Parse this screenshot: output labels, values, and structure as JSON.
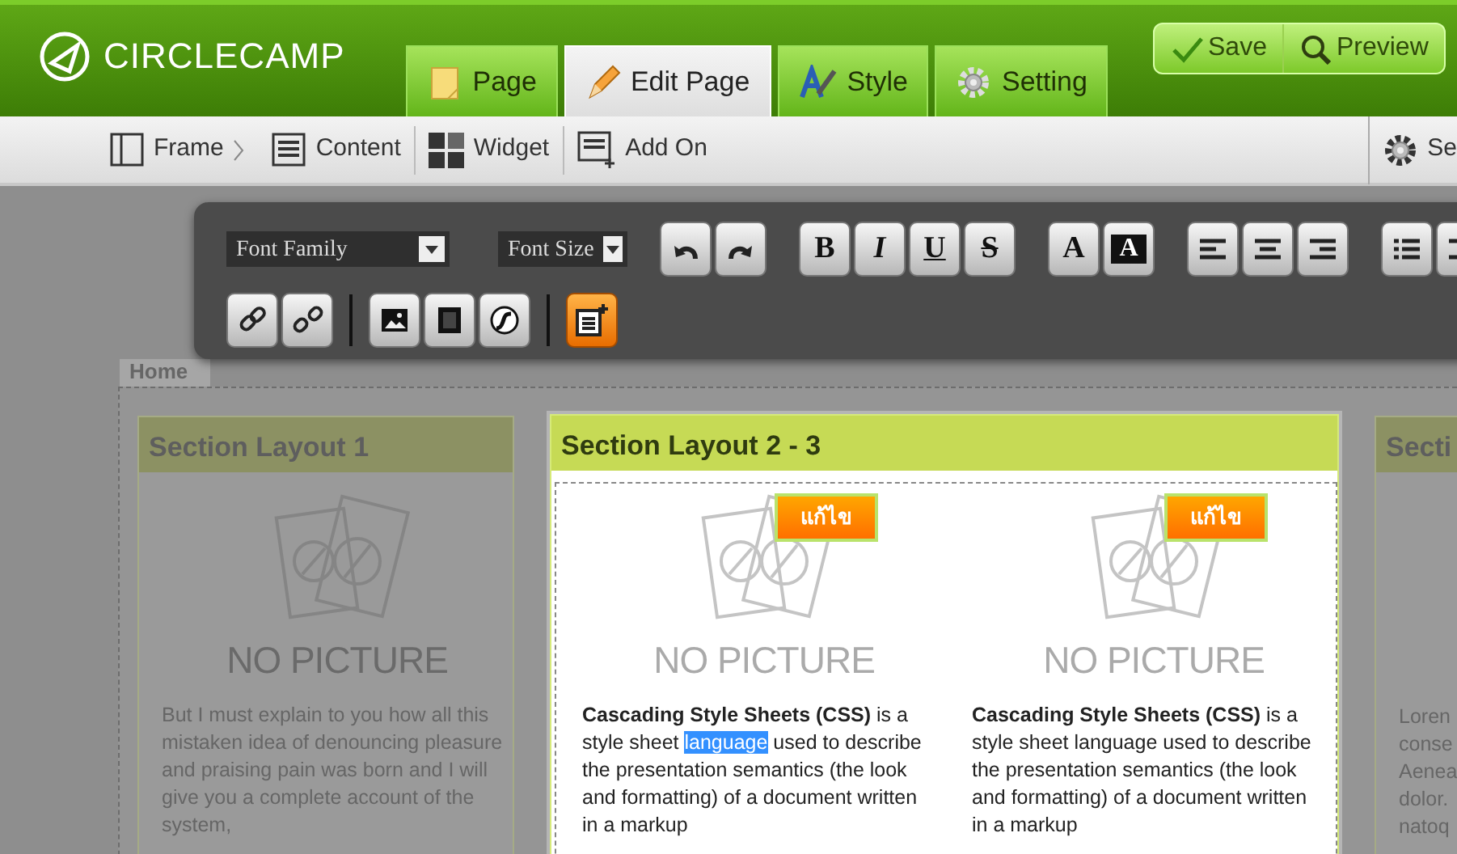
{
  "app": {
    "logo": "CIRCLECAMP"
  },
  "tabs": [
    {
      "label": "Page",
      "kind": "page",
      "selected": false
    },
    {
      "label": "Edit Page",
      "kind": "edit",
      "selected": true
    },
    {
      "label": "Style",
      "kind": "style",
      "selected": false
    },
    {
      "label": "Setting",
      "kind": "setting",
      "selected": false
    }
  ],
  "actions": [
    {
      "label": "Save",
      "kind": "save"
    },
    {
      "label": "Preview",
      "kind": "preview"
    }
  ],
  "subbar": {
    "items": [
      {
        "label": "Frame",
        "kind": "frame"
      },
      {
        "label": "Content",
        "kind": "content"
      },
      {
        "label": "Widget",
        "kind": "widget"
      },
      {
        "label": "Add On",
        "kind": "addon"
      }
    ],
    "settings": {
      "label": "Se"
    }
  },
  "toolbar": {
    "rows": [
      [
        [
          {
            "kind": "dropdown",
            "label": "Font Family"
          },
          {
            "kind": "dropdown",
            "label": "Font Size"
          }
        ],
        [
          {
            "kind": "undo",
            "active": false
          },
          {
            "kind": "redo",
            "active": false
          }
        ],
        [
          {
            "kind": "bold",
            "label": "B",
            "active": false
          },
          {
            "kind": "italic",
            "label": "I",
            "active": false
          },
          {
            "kind": "underline",
            "label": "U",
            "active": false
          },
          {
            "kind": "strike",
            "label": "S",
            "active": false
          }
        ],
        [
          {
            "kind": "fontcolor",
            "label": "A",
            "active": false
          },
          {
            "kind": "bgcolor",
            "label": "A",
            "active": false
          }
        ],
        [
          {
            "kind": "alignleft",
            "active": false
          },
          {
            "kind": "aligncenter",
            "active": false
          },
          {
            "kind": "alignright",
            "active": false
          }
        ],
        [
          {
            "kind": "list",
            "active": false
          },
          {
            "kind": "indent",
            "active": false
          }
        ]
      ],
      [
        [
          {
            "kind": "link",
            "active": false
          },
          {
            "kind": "unlink",
            "active": false
          }
        ],
        [
          {
            "kind": "image",
            "active": false
          },
          {
            "kind": "video",
            "active": false
          },
          {
            "kind": "flash",
            "active": false
          }
        ],
        [
          {
            "kind": "note",
            "active": true
          }
        ]
      ]
    ]
  },
  "page_tab": "Home",
  "sections": [
    {
      "title": "Section Layout 1",
      "dim": true,
      "items": [
        {
          "picture": "NO PICTURE",
          "paragraph": [
            {
              "text": "But I must explain to you how all this mistaken idea of denouncing pleasure and praising pain was born and I will give you a complete account of the system,",
              "highlighted": false
            }
          ]
        }
      ]
    },
    {
      "title": "Section Layout 2 - 3",
      "dim": false,
      "items": [
        {
          "picture": "NO PICTURE",
          "edit": "แก้ไข",
          "paragraph": [
            {
              "text": "**Cascading Style Sheets (CSS)** is a style sheet ",
              "highlighted": false
            },
            {
              "text": "language",
              "highlighted": true
            },
            {
              "text": " used to describe the presentation semantics (the look and formatting) of a document written in a markup",
              "highlighted": false
            }
          ]
        },
        {
          "picture": "NO PICTURE",
          "edit": "แก้ไข",
          "paragraph": [
            {
              "text": "**Cascading Style Sheets (CSS)** is a style sheet language used to describe the presentation semantics (the look and formatting) of a document written in a markup",
              "highlighted": false
            }
          ]
        }
      ]
    },
    {
      "title": "Secti",
      "dim": true,
      "lines": [
        "Loren",
        "conse",
        "Aenea",
        "dolor.",
        "natoq"
      ]
    }
  ]
}
